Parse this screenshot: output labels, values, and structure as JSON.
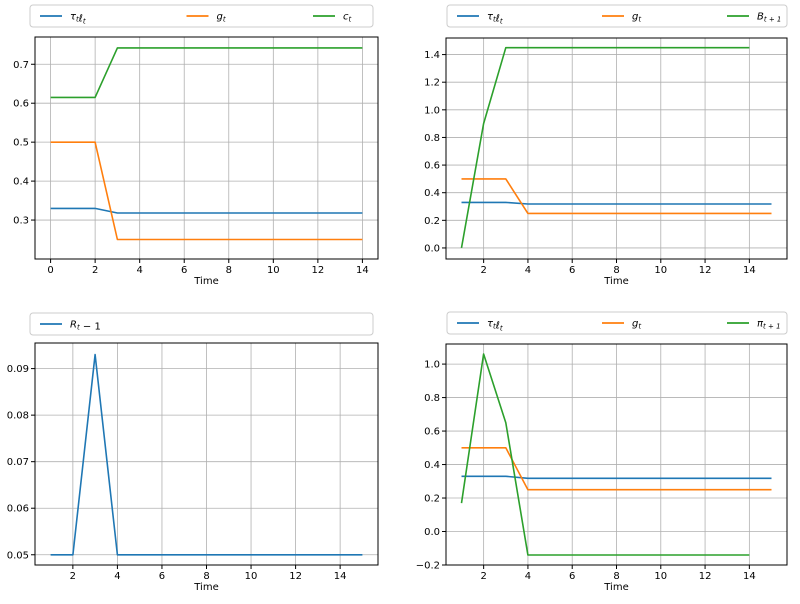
{
  "chart_data": [
    {
      "type": "line",
      "xlabel": "Time",
      "ylabel": "",
      "xlim": [
        -0.7,
        14.7
      ],
      "ylim": [
        0.2,
        0.77
      ],
      "xticks": [
        0,
        2,
        4,
        6,
        8,
        10,
        12,
        14
      ],
      "yticks": [
        0.3,
        0.4,
        0.5,
        0.6,
        0.7
      ],
      "grid": true,
      "legend": "top, above plot, 3 columns",
      "series": [
        {
          "name": "τtℓt",
          "color": "#1f77b4",
          "x": [
            0,
            1,
            2,
            3,
            4,
            5,
            6,
            7,
            8,
            9,
            10,
            11,
            12,
            13,
            14
          ],
          "y": [
            0.33,
            0.33,
            0.33,
            0.318,
            0.318,
            0.318,
            0.318,
            0.318,
            0.318,
            0.318,
            0.318,
            0.318,
            0.318,
            0.318,
            0.318
          ]
        },
        {
          "name": "gt",
          "color": "#ff7f0e",
          "x": [
            0,
            1,
            2,
            3,
            4,
            5,
            6,
            7,
            8,
            9,
            10,
            11,
            12,
            13,
            14
          ],
          "y": [
            0.5,
            0.5,
            0.5,
            0.25,
            0.25,
            0.25,
            0.25,
            0.25,
            0.25,
            0.25,
            0.25,
            0.25,
            0.25,
            0.25,
            0.25
          ]
        },
        {
          "name": "ct",
          "color": "#2ca02c",
          "x": [
            0,
            1,
            2,
            3,
            4,
            5,
            6,
            7,
            8,
            9,
            10,
            11,
            12,
            13,
            14
          ],
          "y": [
            0.615,
            0.615,
            0.615,
            0.742,
            0.742,
            0.742,
            0.742,
            0.742,
            0.742,
            0.742,
            0.742,
            0.742,
            0.742,
            0.742,
            0.742
          ]
        }
      ]
    },
    {
      "type": "line",
      "xlabel": "Time",
      "ylabel": "",
      "xlim": [
        0.3,
        15.7
      ],
      "ylim": [
        -0.08,
        1.52
      ],
      "xticks": [
        2,
        4,
        6,
        8,
        10,
        12,
        14
      ],
      "yticks": [
        0.0,
        0.2,
        0.4,
        0.6,
        0.8,
        1.0,
        1.2,
        1.4
      ],
      "grid": true,
      "legend": "top, above plot, 3 columns",
      "series": [
        {
          "name": "τtℓt",
          "color": "#1f77b4",
          "x": [
            1,
            2,
            3,
            4,
            5,
            6,
            7,
            8,
            9,
            10,
            11,
            12,
            13,
            14,
            15
          ],
          "y": [
            0.33,
            0.33,
            0.33,
            0.318,
            0.318,
            0.318,
            0.318,
            0.318,
            0.318,
            0.318,
            0.318,
            0.318,
            0.318,
            0.318,
            0.318
          ]
        },
        {
          "name": "gt",
          "color": "#ff7f0e",
          "x": [
            1,
            2,
            3,
            4,
            5,
            6,
            7,
            8,
            9,
            10,
            11,
            12,
            13,
            14,
            15
          ],
          "y": [
            0.5,
            0.5,
            0.5,
            0.25,
            0.25,
            0.25,
            0.25,
            0.25,
            0.25,
            0.25,
            0.25,
            0.25,
            0.25,
            0.25,
            0.25
          ]
        },
        {
          "name": "Bt+1",
          "color": "#2ca02c",
          "x": [
            1,
            2,
            3,
            4,
            5,
            6,
            7,
            8,
            9,
            10,
            11,
            12,
            13,
            14
          ],
          "y": [
            0.0,
            0.9,
            1.45,
            1.45,
            1.45,
            1.45,
            1.45,
            1.45,
            1.45,
            1.45,
            1.45,
            1.45,
            1.45,
            1.45
          ]
        }
      ]
    },
    {
      "type": "line",
      "xlabel": "Time",
      "ylabel": "",
      "xlim": [
        0.3,
        15.7
      ],
      "ylim": [
        0.0478,
        0.0955
      ],
      "xticks": [
        2,
        4,
        6,
        8,
        10,
        12,
        14
      ],
      "yticks": [
        0.05,
        0.06,
        0.07,
        0.08,
        0.09
      ],
      "grid": true,
      "legend": "top, above plot, 1 column",
      "series": [
        {
          "name": "Rt − 1",
          "color": "#1f77b4",
          "x": [
            1,
            2,
            3,
            4,
            5,
            6,
            7,
            8,
            9,
            10,
            11,
            12,
            13,
            14,
            15
          ],
          "y": [
            0.05,
            0.05,
            0.093,
            0.05,
            0.05,
            0.05,
            0.05,
            0.05,
            0.05,
            0.05,
            0.05,
            0.05,
            0.05,
            0.05,
            0.05
          ]
        }
      ]
    },
    {
      "type": "line",
      "xlabel": "Time",
      "ylabel": "",
      "xlim": [
        0.3,
        15.7
      ],
      "ylim": [
        -0.2,
        1.12
      ],
      "xticks": [
        2,
        4,
        6,
        8,
        10,
        12,
        14
      ],
      "yticks": [
        -0.2,
        0.0,
        0.2,
        0.4,
        0.6,
        0.8,
        1.0
      ],
      "grid": true,
      "legend": "top, above plot, 3 columns",
      "series": [
        {
          "name": "τtℓt",
          "color": "#1f77b4",
          "x": [
            1,
            2,
            3,
            4,
            5,
            6,
            7,
            8,
            9,
            10,
            11,
            12,
            13,
            14,
            15
          ],
          "y": [
            0.33,
            0.33,
            0.33,
            0.318,
            0.318,
            0.318,
            0.318,
            0.318,
            0.318,
            0.318,
            0.318,
            0.318,
            0.318,
            0.318,
            0.318
          ]
        },
        {
          "name": "gt",
          "color": "#ff7f0e",
          "x": [
            1,
            2,
            3,
            4,
            5,
            6,
            7,
            8,
            9,
            10,
            11,
            12,
            13,
            14,
            15
          ],
          "y": [
            0.5,
            0.5,
            0.5,
            0.25,
            0.25,
            0.25,
            0.25,
            0.25,
            0.25,
            0.25,
            0.25,
            0.25,
            0.25,
            0.25,
            0.25
          ]
        },
        {
          "name": "πt+1",
          "color": "#2ca02c",
          "x": [
            1,
            2,
            3,
            4,
            5,
            6,
            7,
            8,
            9,
            10,
            11,
            12,
            13,
            14
          ],
          "y": [
            0.17,
            1.06,
            0.65,
            -0.14,
            -0.14,
            -0.14,
            -0.14,
            -0.14,
            -0.14,
            -0.14,
            -0.14,
            -0.14,
            -0.14,
            -0.14
          ]
        }
      ]
    }
  ]
}
